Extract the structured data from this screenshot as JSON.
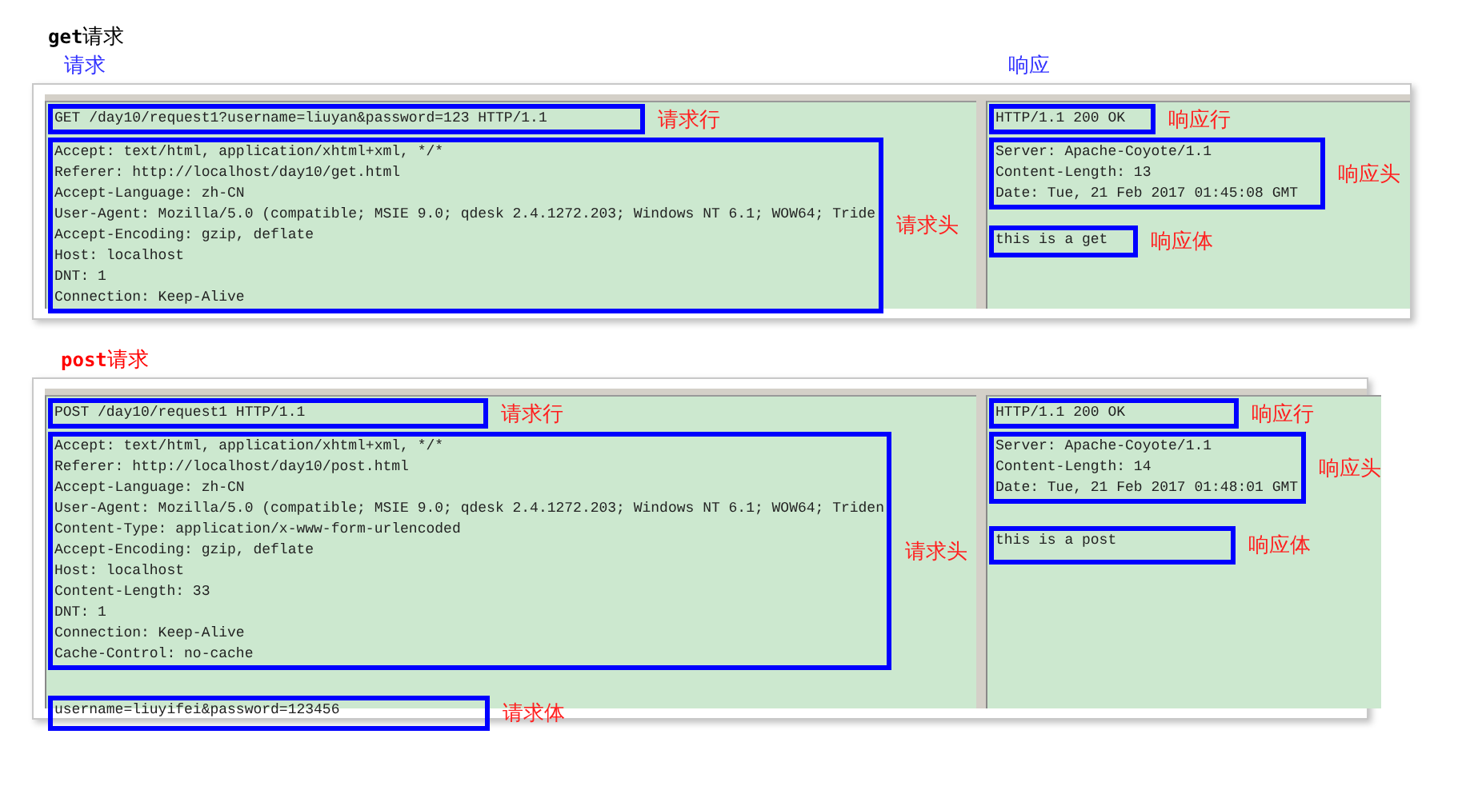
{
  "sections": [
    {
      "title": "**get**请求",
      "color": "#000000",
      "pane_labels": [
        "请求",
        "响应"
      ],
      "request": [
        {
          "lines": [
            "GET /day10/request1?username=liuyan&password=123 HTTP/1.1"
          ],
          "label": "请求行"
        },
        {
          "lines": [
            "Accept: text/html, application/xhtml+xml, */*",
            "Referer: http://localhost/day10/get.html",
            "Accept-Language: zh-CN",
            "User-Agent: Mozilla/5.0 (compatible; MSIE 9.0; qdesk 2.4.1272.203; Windows NT 6.1; WOW64; Tride",
            "Accept-Encoding: gzip, deflate",
            "Host: localhost",
            "DNT: 1",
            "Connection: Keep-Alive"
          ],
          "label": "请求头"
        }
      ],
      "response": [
        {
          "lines": [
            "HTTP/1.1 200 OK"
          ],
          "label": "响应行"
        },
        {
          "lines": [
            "Server: Apache-Coyote/1.1",
            "Content-Length: 13",
            "Date: Tue, 21 Feb 2017 01:45:08 GMT"
          ],
          "label": "响应头"
        },
        {
          "lines": [
            "this is a get"
          ],
          "label": "响应体"
        }
      ]
    },
    {
      "title": "**post**请求",
      "color": "#ff0000",
      "request": [
        {
          "lines": [
            "POST /day10/request1 HTTP/1.1"
          ],
          "label": "请求行"
        },
        {
          "lines": [
            "Accept: text/html, application/xhtml+xml, */*",
            "Referer: http://localhost/day10/post.html",
            "Accept-Language: zh-CN",
            "User-Agent: Mozilla/5.0 (compatible; MSIE 9.0; qdesk 2.4.1272.203; Windows NT 6.1; WOW64; Triden",
            "Content-Type: application/x-www-form-urlencoded",
            "Accept-Encoding: gzip, deflate",
            "Host: localhost",
            "Content-Length: 33",
            "DNT: 1",
            "Connection: Keep-Alive",
            "Cache-Control: no-cache"
          ],
          "label": "请求头"
        },
        {
          "lines": [
            "username=liuyifei&password=123456"
          ],
          "label": "请求体"
        }
      ],
      "response": [
        {
          "lines": [
            "HTTP/1.1 200 OK"
          ],
          "label": "响应行"
        },
        {
          "lines": [
            "Server: Apache-Coyote/1.1",
            "Content-Length: 14",
            "Date: Tue, 21 Feb 2017 01:48:01 GMT"
          ],
          "label": "响应头"
        },
        {
          "lines": [
            "this is a post"
          ],
          "label": "响应体"
        }
      ]
    }
  ]
}
